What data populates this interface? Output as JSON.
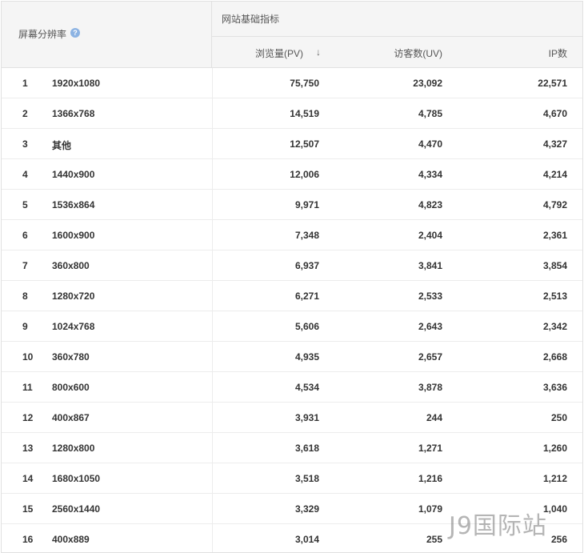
{
  "header": {
    "resolution_col": "屏幕分辨率",
    "help_icon": "?",
    "group_title": "网站基础指标",
    "pv_col": "浏览量(PV)",
    "sort_icon": "↓",
    "uv_col": "访客数(UV)",
    "ip_col": "IP数"
  },
  "rows": [
    {
      "idx": "1",
      "res": "1920x1080",
      "pv": "75,750",
      "uv": "23,092",
      "ip": "22,571"
    },
    {
      "idx": "2",
      "res": "1366x768",
      "pv": "14,519",
      "uv": "4,785",
      "ip": "4,670"
    },
    {
      "idx": "3",
      "res": "其他",
      "pv": "12,507",
      "uv": "4,470",
      "ip": "4,327"
    },
    {
      "idx": "4",
      "res": "1440x900",
      "pv": "12,006",
      "uv": "4,334",
      "ip": "4,214"
    },
    {
      "idx": "5",
      "res": "1536x864",
      "pv": "9,971",
      "uv": "4,823",
      "ip": "4,792"
    },
    {
      "idx": "6",
      "res": "1600x900",
      "pv": "7,348",
      "uv": "2,404",
      "ip": "2,361"
    },
    {
      "idx": "7",
      "res": "360x800",
      "pv": "6,937",
      "uv": "3,841",
      "ip": "3,854"
    },
    {
      "idx": "8",
      "res": "1280x720",
      "pv": "6,271",
      "uv": "2,533",
      "ip": "2,513"
    },
    {
      "idx": "9",
      "res": "1024x768",
      "pv": "5,606",
      "uv": "2,643",
      "ip": "2,342"
    },
    {
      "idx": "10",
      "res": "360x780",
      "pv": "4,935",
      "uv": "2,657",
      "ip": "2,668"
    },
    {
      "idx": "11",
      "res": "800x600",
      "pv": "4,534",
      "uv": "3,878",
      "ip": "3,636"
    },
    {
      "idx": "12",
      "res": "400x867",
      "pv": "3,931",
      "uv": "244",
      "ip": "250"
    },
    {
      "idx": "13",
      "res": "1280x800",
      "pv": "3,618",
      "uv": "1,271",
      "ip": "1,260"
    },
    {
      "idx": "14",
      "res": "1680x1050",
      "pv": "3,518",
      "uv": "1,216",
      "ip": "1,212"
    },
    {
      "idx": "15",
      "res": "2560x1440",
      "pv": "3,329",
      "uv": "1,079",
      "ip": "1,040"
    },
    {
      "idx": "16",
      "res": "400x889",
      "pv": "3,014",
      "uv": "255",
      "ip": "256"
    }
  ],
  "watermark": "J9国际站"
}
